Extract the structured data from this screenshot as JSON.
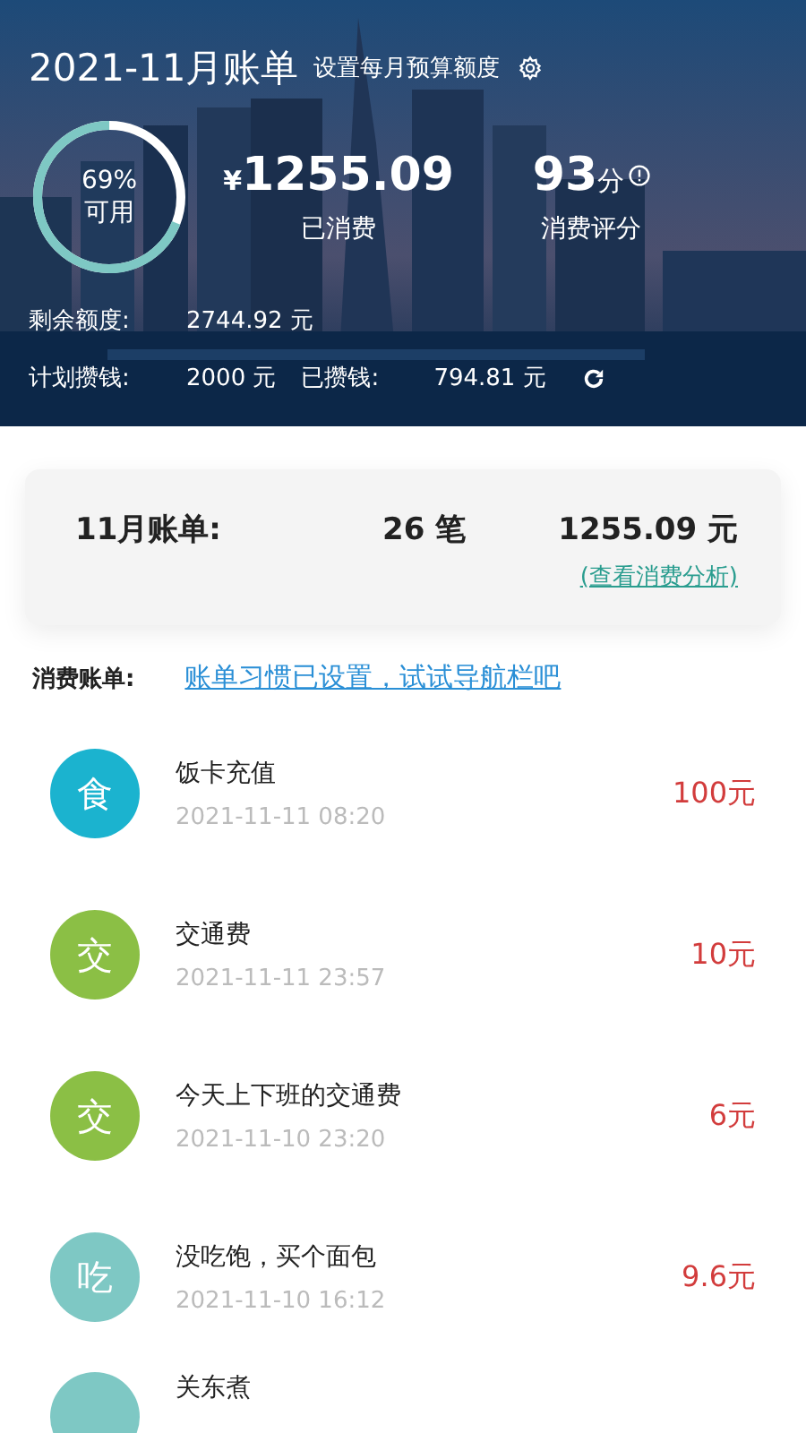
{
  "header": {
    "title": "2021-11月账单",
    "budget_link": "设置每月预算额度",
    "ring": {
      "level": 0.69,
      "percent": "69%",
      "label": "可用"
    },
    "spent": {
      "currency": "¥",
      "amount": "1255.09",
      "label": "已消费"
    },
    "score": {
      "value": "93",
      "unit": "分",
      "label": "消费评分"
    },
    "remaining": {
      "label": "剩余额度:",
      "value": "2744.92 元"
    },
    "plan": {
      "label": "计划攒钱:",
      "value": "2000 元",
      "saved_label": "已攒钱:",
      "saved_value": "794.81 元"
    }
  },
  "summary": {
    "label": "11月账单:",
    "count": "26 笔",
    "total": "1255.09 元",
    "link": "(查看消费分析)"
  },
  "bills_label": "消费账单:",
  "hint_link": "账单习惯已设置，试试导航栏吧",
  "bills": [
    {
      "category": "食",
      "color": "#1bb3cf",
      "title": "饭卡充值",
      "time": "2021-11-11 08:20",
      "amount": "100元"
    },
    {
      "category": "交",
      "color": "#8bbf45",
      "title": "交通费",
      "time": "2021-11-11 23:57",
      "amount": "10元"
    },
    {
      "category": "交",
      "color": "#8bbf45",
      "title": "今天上下班的交通费",
      "time": "2021-11-10 23:20",
      "amount": "6元"
    },
    {
      "category": "吃",
      "color": "#7ec8c4",
      "title": "没吃饱，买个面包",
      "time": "2021-11-10 16:12",
      "amount": "9.6元"
    },
    {
      "color": "#7ec8c4",
      "title": "关东煮"
    }
  ]
}
